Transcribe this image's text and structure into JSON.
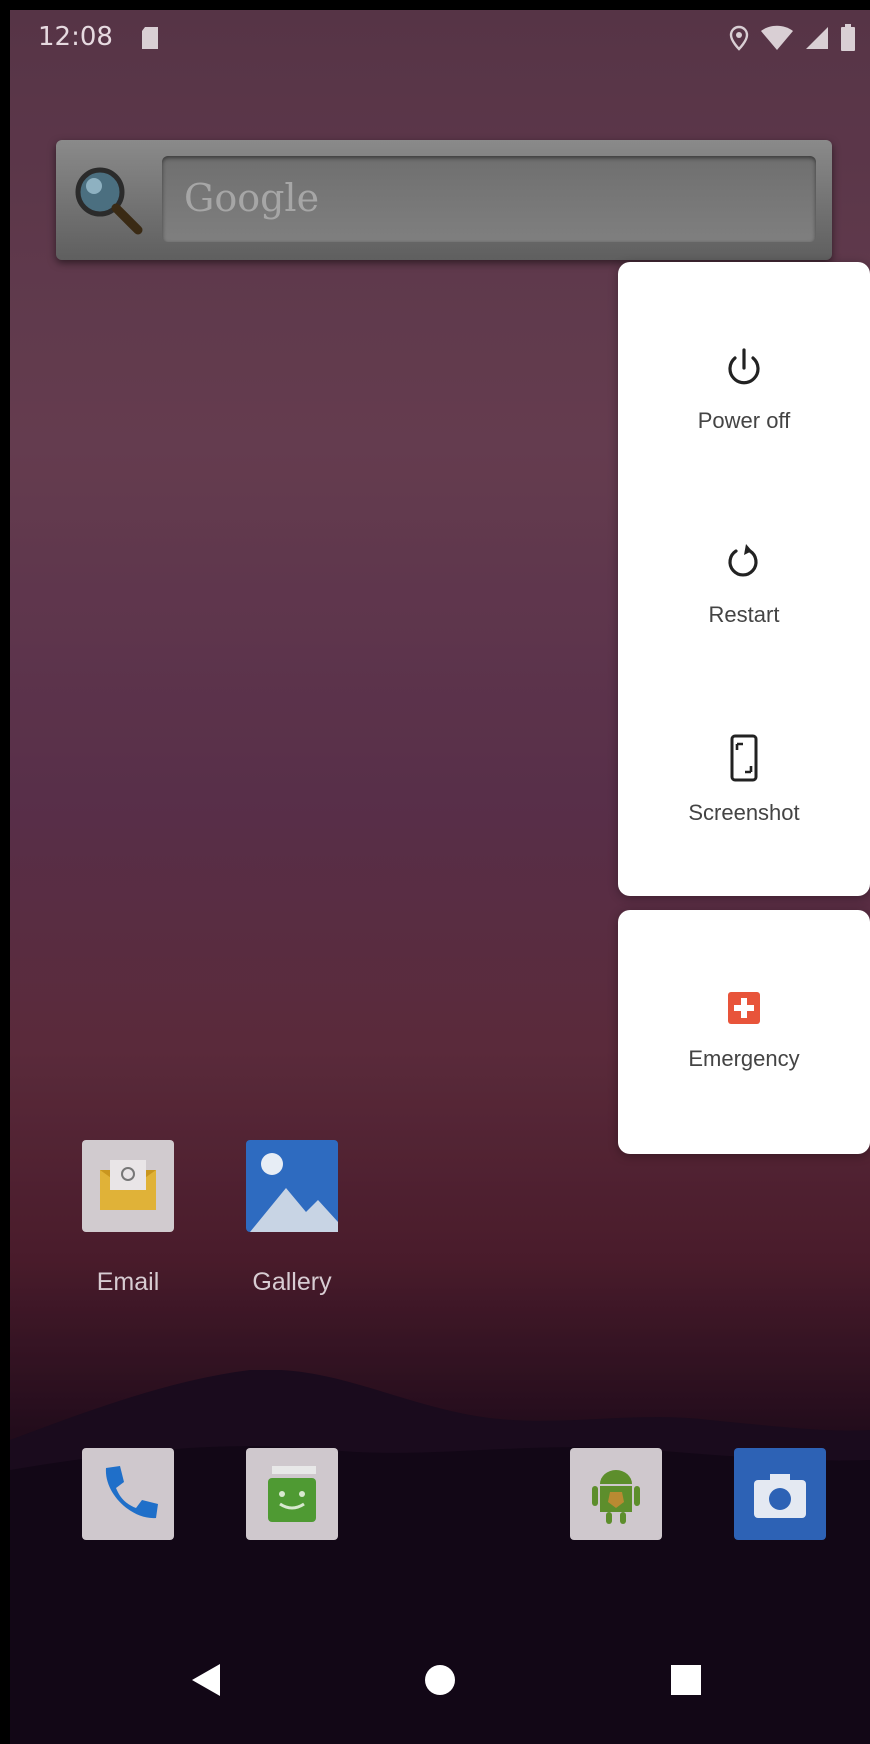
{
  "status_bar": {
    "time": "12:08",
    "icons": [
      "sd-card-icon",
      "location-icon",
      "wifi-icon",
      "signal-icon",
      "battery-icon"
    ]
  },
  "search_widget": {
    "placeholder": "Google",
    "icon": "search-icon"
  },
  "power_menu": {
    "items": [
      {
        "label": "Power off",
        "icon": "power-icon"
      },
      {
        "label": "Restart",
        "icon": "restart-icon"
      },
      {
        "label": "Screenshot",
        "icon": "screenshot-icon"
      }
    ],
    "emergency": {
      "label": "Emergency",
      "icon": "emergency-icon",
      "color": "#e8543a"
    }
  },
  "home_apps": [
    {
      "label": "Email",
      "icon": "email-icon"
    },
    {
      "label": "Gallery",
      "icon": "gallery-icon"
    }
  ],
  "dock": [
    {
      "icon": "phone-icon"
    },
    {
      "icon": "messenger-icon"
    },
    {
      "icon": "android-icon"
    },
    {
      "icon": "camera-icon"
    }
  ],
  "nav_bar": {
    "buttons": [
      "back-icon",
      "home-icon",
      "recents-icon"
    ]
  }
}
